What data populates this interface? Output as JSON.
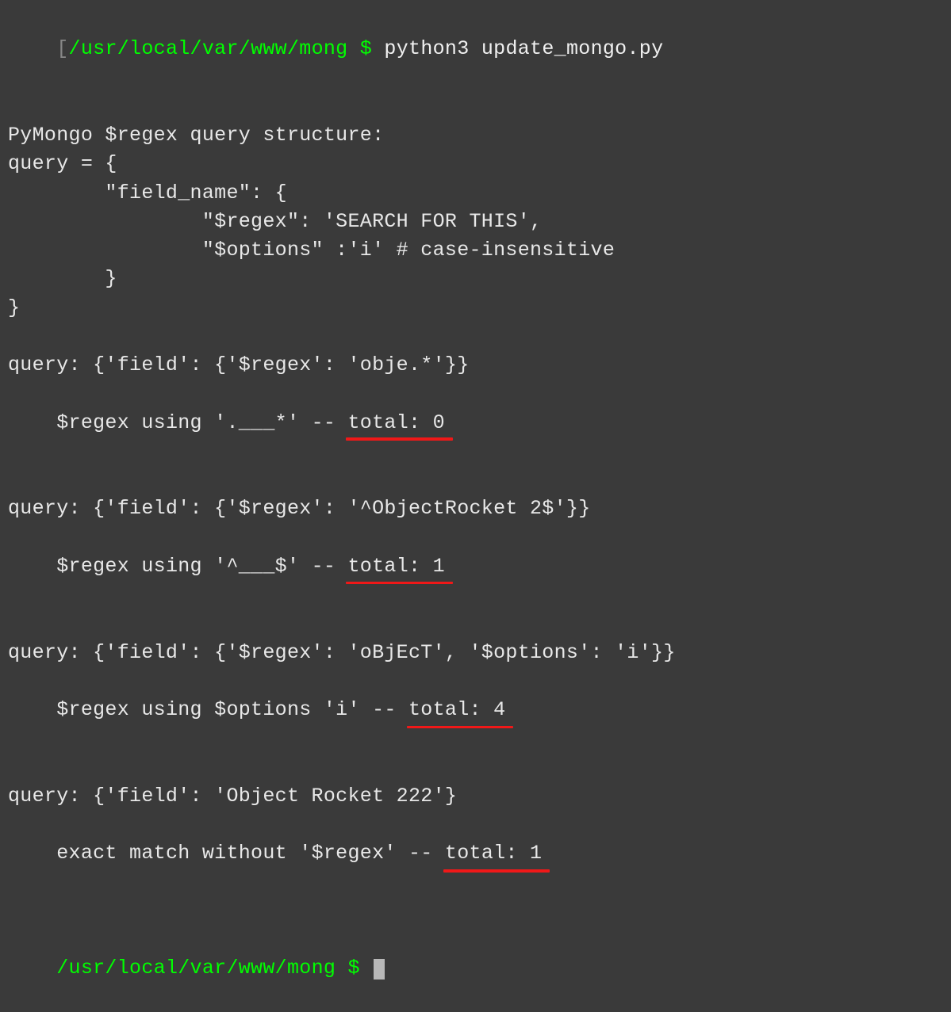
{
  "prompt1_bracket": "[",
  "prompt1_path": "/usr/local/var/www/mong",
  "prompt1_dollar": " $ ",
  "prompt1_cmd": "python3 update_mongo.py",
  "blank": "",
  "struct_header": "PyMongo $regex query structure:",
  "struct_l1": "query = {",
  "struct_l2": "        \"field_name\": {",
  "struct_l3": "                \"$regex\": 'SEARCH FOR THIS',",
  "struct_l4": "                \"$options\" :'i' # case-insensitive",
  "struct_l5": "        }",
  "struct_l6": "}",
  "q1_line1": "query: {'field': {'$regex': 'obje.*'}}",
  "q1_line2_a": "$regex using '.___*' -- ",
  "q1_line2_b": "total: 0",
  "q2_line1": "query: {'field': {'$regex': '^ObjectRocket 2$'}}",
  "q2_line2_a": "$regex using '^___$' -- ",
  "q2_line2_b": "total: 1",
  "q3_line1": "query: {'field': {'$regex': 'oBjEcT', '$options': 'i'}}",
  "q3_line2_a": "$regex using $options 'i' -- ",
  "q3_line2_b": "total: 4",
  "q4_line1": "query: {'field': 'Object Rocket 222'}",
  "q4_line2_a": "exact match without '$regex' -- ",
  "q4_line2_b": "total: 1",
  "prompt2_path": "/usr/local/var/www/mong",
  "prompt2_dollar": " $ "
}
